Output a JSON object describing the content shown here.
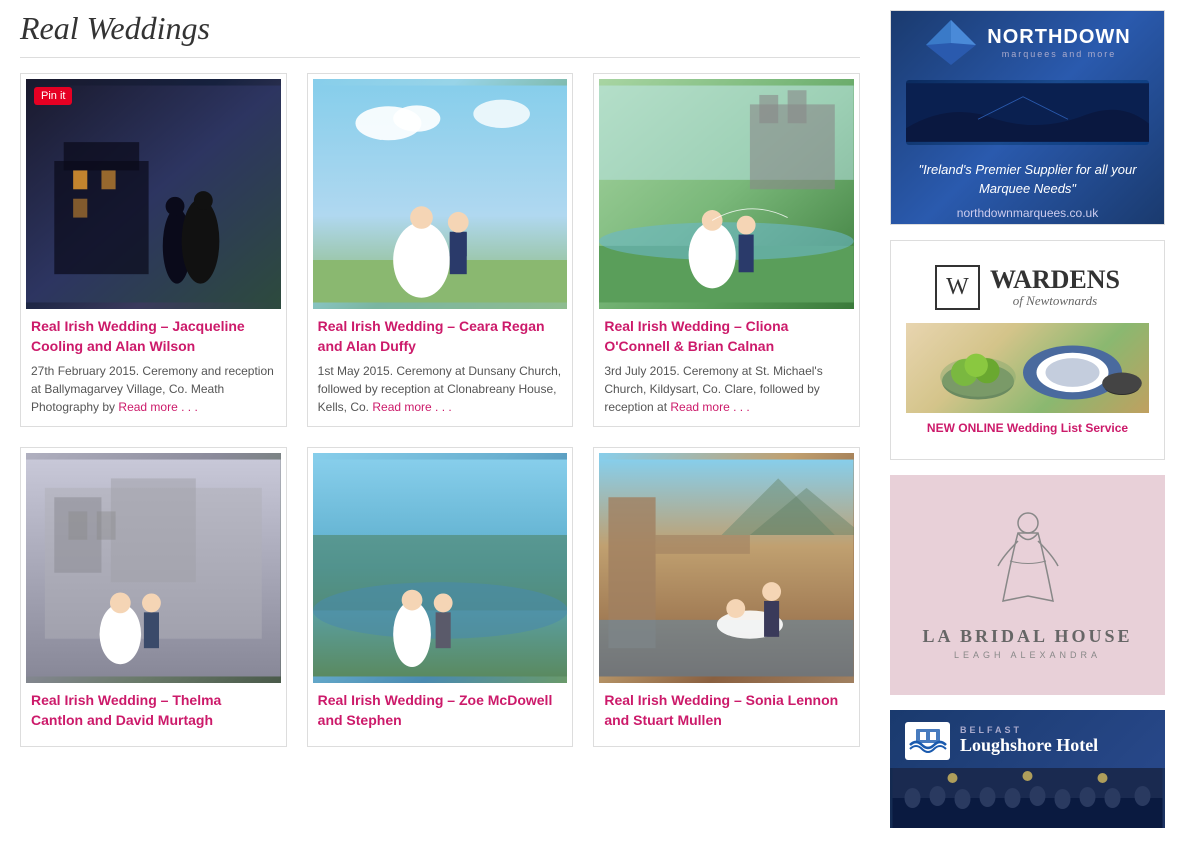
{
  "page": {
    "title": "Real Weddings"
  },
  "weddings": [
    {
      "id": "jacqueline-alan",
      "title": "Real Irish Wedding – Jacqueline Cooling and Alan Wilson",
      "description": "27th February 2015. Ceremony and reception at Ballymagarvey Village, Co. Meath Photography by",
      "read_more": "Read more . . .",
      "image_class": "img-dark"
    },
    {
      "id": "ceara-alan",
      "title": "Real Irish Wedding – Ceara Regan and Alan Duffy",
      "description": "1st May 2015. Ceremony at Dunsany Church, followed by reception at Clonabreany House, Kells, Co.",
      "read_more": "Read more . . .",
      "image_class": "img-outdoor"
    },
    {
      "id": "cliona-brian",
      "title": "Real Irish Wedding – Cliona O'Connell & Brian Calnan",
      "description": "3rd July 2015. Ceremony at St. Michael's Church, Kildysart, Co. Clare, followed by reception at",
      "read_more": "Read more . . .",
      "image_class": "img-green"
    },
    {
      "id": "thelma-david",
      "title": "Real Irish Wedding – Thelma Cantlon and David Murtagh",
      "description": "",
      "read_more": "",
      "image_class": "img-castle"
    },
    {
      "id": "zoe-stephen",
      "title": "Real Irish Wedding – Zoe McDowell and Stephen",
      "description": "",
      "read_more": "",
      "image_class": "img-lake"
    },
    {
      "id": "sonia-stuart",
      "title": "Real Irish Wedding – Sonia Lennon and Stuart Mullen",
      "description": "",
      "read_more": "",
      "image_class": "img-travel"
    }
  ],
  "sidebar": {
    "ads": [
      {
        "id": "northdown",
        "name": "Northdown Marquees",
        "quote": "\"Ireland's Premier Supplier for all your Marquee Needs\"",
        "url": "northdownmarquees.co.uk"
      },
      {
        "id": "wardens",
        "name": "Wardens of Newtownards",
        "tagline": "NEW ONLINE Wedding List Service"
      },
      {
        "id": "la-bridal",
        "name": "LA BRIDAL HOUSE",
        "subtitle": "LEAGH ALEXANDRA"
      },
      {
        "id": "loughshore",
        "name": "Loughshore Hotel",
        "location": "BELFAST"
      }
    ]
  },
  "pin_it": "Pin it"
}
